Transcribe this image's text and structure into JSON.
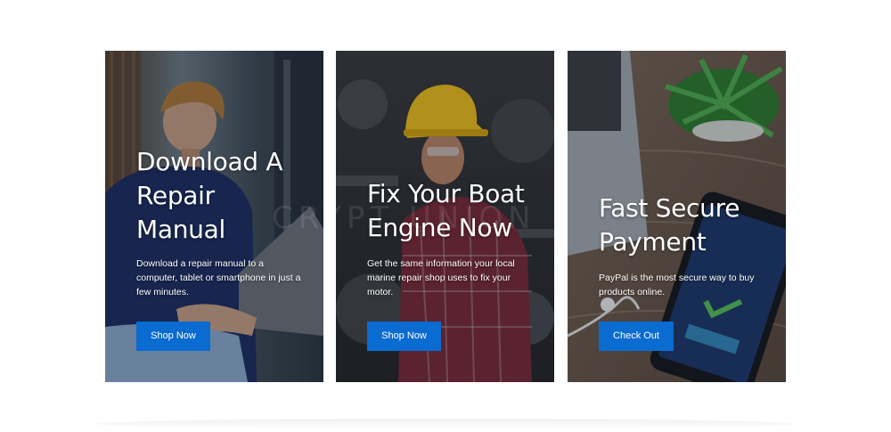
{
  "cards": [
    {
      "title": "Download A Repair Manual",
      "description": "Download a repair manual to a computer, tablet or smartphone in just a few minutes.",
      "button_label": "Shop Now",
      "image_icon": "man-with-laptop-photo"
    },
    {
      "title": "Fix Your Boat Engine Now",
      "description": "Get the same information your local marine repair shop uses to fix your motor.",
      "button_label": "Shop Now",
      "image_icon": "mechanic-hardhat-photo"
    },
    {
      "title": "Fast Secure Payment",
      "description": "PayPal is the most secure way to buy products online.",
      "button_label": "Check Out",
      "image_icon": "phone-transaction-photo"
    }
  ],
  "watermark_text": "CRYPT  UNION",
  "colors": {
    "button": "#0a6bd1",
    "text": "#ffffff"
  }
}
